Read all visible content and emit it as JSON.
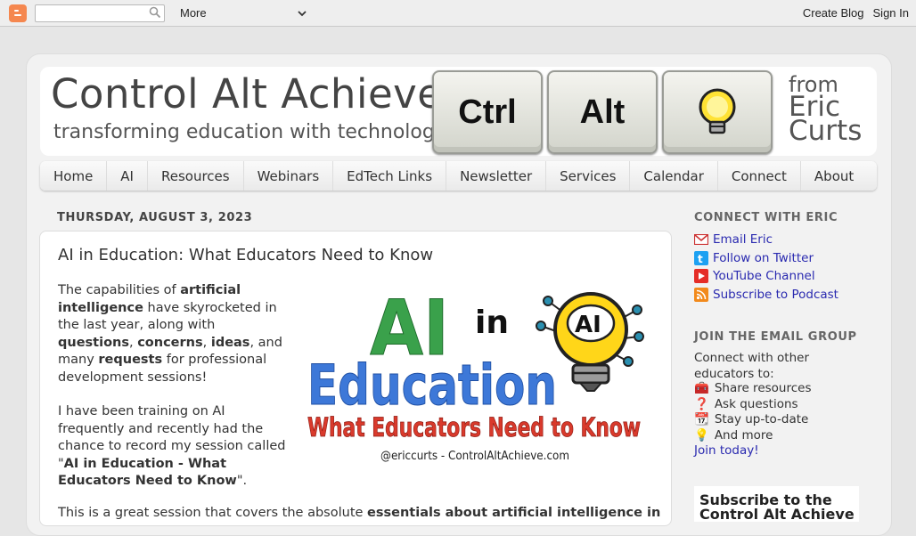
{
  "navbar": {
    "more_label": "More",
    "create_blog": "Create Blog",
    "sign_in": "Sign In"
  },
  "header": {
    "title": "Control Alt Achieve",
    "subtitle": "transforming education with technology",
    "keys": [
      "Ctrl",
      "Alt"
    ],
    "from_line1": "from",
    "from_line2": "Eric",
    "from_line3": "Curts"
  },
  "tabs": [
    "Home",
    "AI",
    "Resources",
    "Webinars",
    "EdTech Links",
    "Newsletter",
    "Services",
    "Calendar",
    "Connect",
    "About"
  ],
  "post": {
    "date": "THURSDAY, AUGUST 3, 2023",
    "title": "AI in Education: What Educators Need to Know",
    "image": {
      "line_ai": "AI",
      "line_in": "in",
      "line_education": "Education",
      "line_tagline": "What Educators Need to Know",
      "credit": "@ericcurts - ControlAltAchieve.com",
      "bulb_text": "AI"
    },
    "p1": {
      "t1": "The capabilities of ",
      "b1": "artificial intelligence",
      "t2": " have skyrocketed in the last year, along with ",
      "b2": "questions",
      "t3": ", ",
      "b3": "concerns",
      "t4": ", ",
      "b4": "ideas",
      "t5": ", and many ",
      "b5": "requests",
      "t6": " for professional development sessions!"
    },
    "p2": {
      "t1": "I have been training on AI frequently and recently had the chance to record my session called \"",
      "b1": "AI in Education - What Educators Need to Know",
      "t2": "\"."
    },
    "p3": {
      "t1": "This is a great session that covers the absolute ",
      "b1": "essentials about artificial intelligence in"
    }
  },
  "sidebar": {
    "connect_heading": "CONNECT WITH ERIC",
    "connect_links": [
      {
        "label": "Email Eric",
        "icon": "email-icon"
      },
      {
        "label": "Follow on Twitter",
        "icon": "twitter-icon"
      },
      {
        "label": "YouTube Channel",
        "icon": "youtube-icon"
      },
      {
        "label": "Subscribe to Podcast",
        "icon": "rss-icon"
      }
    ],
    "email_heading": "JOIN THE EMAIL GROUP",
    "email_intro": "Connect with other educators to:",
    "email_items": [
      {
        "emoji": "🧰",
        "label": "Share resources"
      },
      {
        "emoji": "❓",
        "label": "Ask questions"
      },
      {
        "emoji": "📆",
        "label": "Stay up-to-date"
      },
      {
        "emoji": "💡",
        "label": "And more"
      }
    ],
    "join_label": "Join today!",
    "subscribe_box": "Subscribe to the Control Alt Achieve"
  }
}
